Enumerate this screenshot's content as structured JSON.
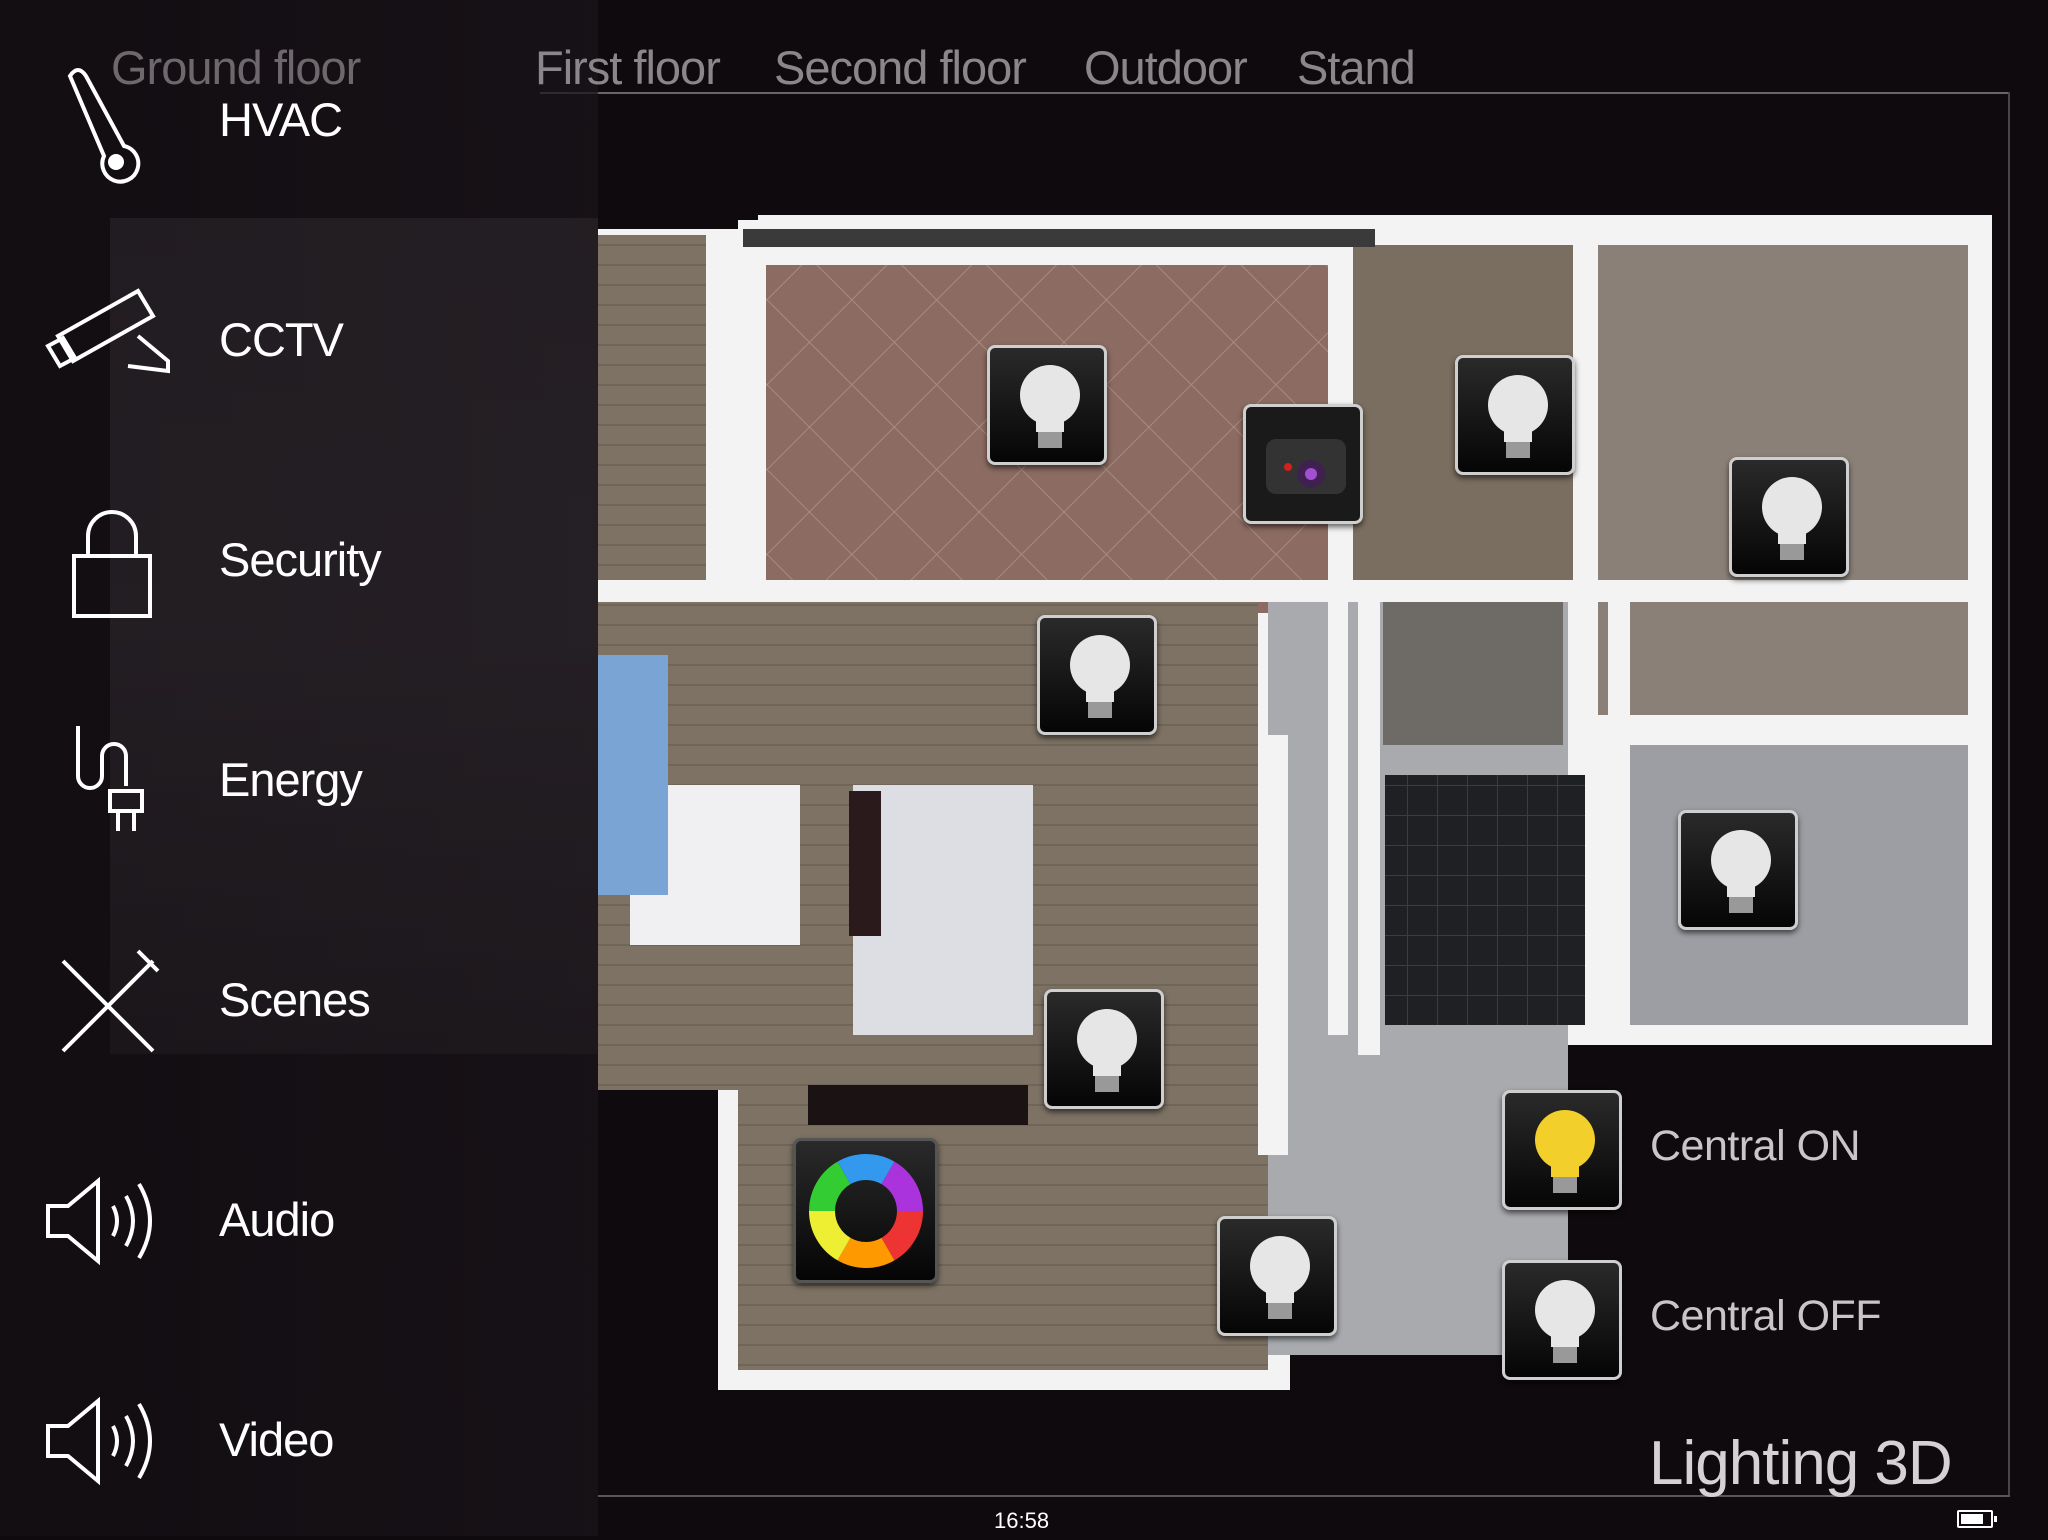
{
  "tabs": [
    {
      "label": "Ground floor",
      "active": true
    },
    {
      "label": "First floor",
      "active": false
    },
    {
      "label": "Second floor",
      "active": false
    },
    {
      "label": "Outdoor",
      "active": false
    },
    {
      "label": "Stand",
      "active": false
    }
  ],
  "sidebar": {
    "items": [
      {
        "label": "HVAC",
        "icon": "thermometer-icon"
      },
      {
        "label": "CCTV",
        "icon": "camera-icon"
      },
      {
        "label": "Security",
        "icon": "padlock-icon"
      },
      {
        "label": "Energy",
        "icon": "plug-icon"
      },
      {
        "label": "Scenes",
        "icon": "fork-knife-icon"
      },
      {
        "label": "Audio",
        "icon": "speaker-icon"
      },
      {
        "label": "Video",
        "icon": "speaker-icon"
      }
    ]
  },
  "controls": {
    "central_on": "Central ON",
    "central_off": "Central OFF",
    "on_color": "#f2cf2a",
    "off_color": "#e6e6e6"
  },
  "page_title": "Lighting 3D",
  "status_bar": {
    "time": "16:58",
    "battery_level": 0.8
  }
}
